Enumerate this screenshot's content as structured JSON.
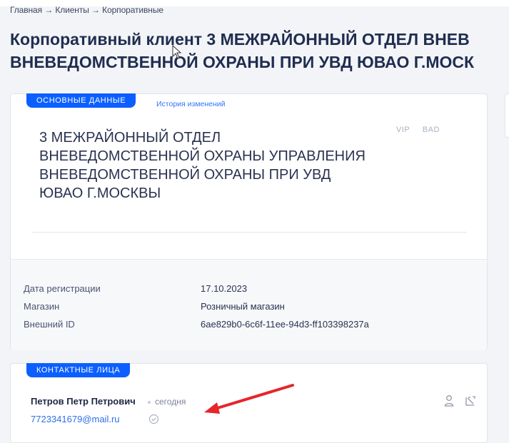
{
  "breadcrumb": "Главная → Клиенты → Корпоративные",
  "title": {
    "line1": "Корпоративный клиент 3 МЕЖРАЙОННЫЙ ОТДЕЛ ВНЕВ",
    "line2": "ВНЕВЕДОМСТВЕННОЙ ОХРАНЫ ПРИ УВД ЮВАО Г.МОСК"
  },
  "main_card": {
    "tab_active": "ОСНОВНЫЕ ДАННЫЕ",
    "tab_history": "История изменений",
    "client_name": [
      "3 МЕЖРАЙОННЫЙ ОТДЕЛ",
      "ВНЕВЕДОМСТВЕННОЙ ОХРАНЫ УПРАВЛЕНИЯ",
      "ВНЕВЕДОМСТВЕННОЙ ОХРАНЫ ПРИ УВД",
      "ЮВАО Г.МОСКВЫ"
    ],
    "badge_vip": "VIP",
    "badge_bad": "BAD",
    "details": [
      {
        "label": "Дата регистрации",
        "value": "17.10.2023"
      },
      {
        "label": "Магазин",
        "value": "Розничный магазин"
      },
      {
        "label": "Внешний ID",
        "value": "6ae829b0-6c6f-11ee-94d3-ff103398237a"
      }
    ]
  },
  "contacts_card": {
    "tab": "КОНТАКТНЫЕ ЛИЦА",
    "contact": {
      "name": "Петров Петр Петрович",
      "time": "сегодня",
      "email": "7723341679@mail.ru"
    }
  },
  "colors": {
    "accent": "#0b5fff",
    "link": "#2f74ff",
    "annotation_arrow": "#e5262b"
  }
}
